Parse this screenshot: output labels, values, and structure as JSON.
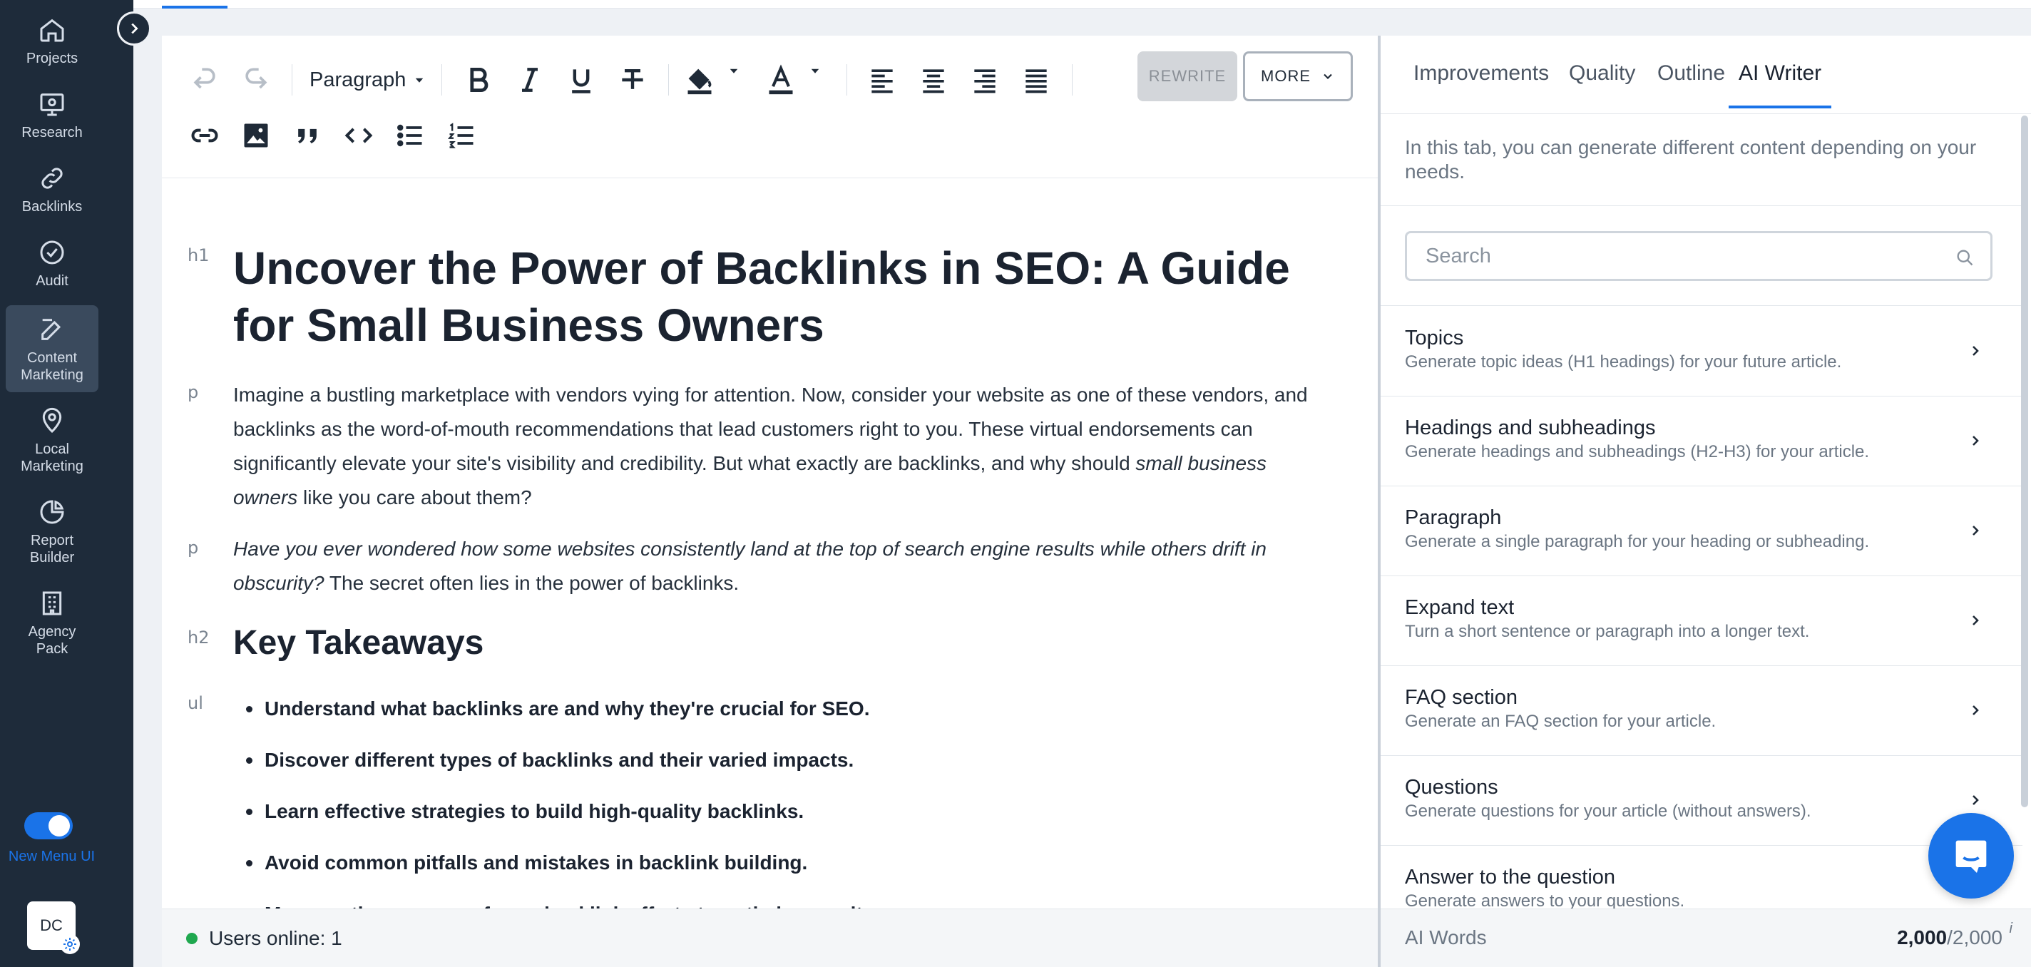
{
  "sidebar": {
    "items": [
      {
        "label": "Projects",
        "icon": "home-icon"
      },
      {
        "label": "Research",
        "icon": "monitor-icon"
      },
      {
        "label": "Backlinks",
        "icon": "link-icon"
      },
      {
        "label": "Audit",
        "icon": "check-circle-icon"
      },
      {
        "label": "Content Marketing",
        "icon": "edit-icon",
        "active": true
      },
      {
        "label": "Local Marketing",
        "icon": "map-pin-icon"
      },
      {
        "label": "Report Builder",
        "icon": "pie-chart-icon"
      },
      {
        "label": "Agency Pack",
        "icon": "building-icon"
      }
    ],
    "toggle_label": "New Menu UI",
    "avatar_initials": "DC"
  },
  "toolbar": {
    "paragraph_select": "Paragraph",
    "rewrite_label": "REWRITE",
    "more_label": "MORE"
  },
  "document": {
    "tags": {
      "h1": "h1",
      "p": "p",
      "h2": "h2",
      "ul": "ul"
    },
    "h1": "Uncover the Power of Backlinks in SEO: A Guide for Small Business Owners",
    "p1_a": "Imagine a bustling marketplace with vendors vying for attention. Now, consider your website as one of these vendors, and backlinks as the word-of-mouth recommendations that lead customers right to you. These virtual endorsements can significantly elevate your site's visibility and credibility. But what exactly are backlinks, and why should ",
    "p1_em": "small business owners",
    "p1_b": " like you care about them?",
    "p2_em": "Have you ever wondered how some websites consistently land at the top of search engine results while others drift in obscurity?",
    "p2_b": " The secret often lies in the power of backlinks.",
    "h2": "Key Takeaways",
    "list": [
      "Understand what backlinks are and why they're crucial for SEO.",
      "Discover different types of backlinks and their varied impacts.",
      "Learn effective strategies to build high-quality backlinks.",
      "Avoid common pitfalls and mistakes in backlink building.",
      "Measure the success of your backlink efforts to optimize results."
    ]
  },
  "status": {
    "users_online": "Users online: 1"
  },
  "right_panel": {
    "tabs": [
      "Improvements",
      "Quality",
      "Outline",
      "AI Writer"
    ],
    "active_tab": "AI Writer",
    "description": "In this tab, you can generate different content depending on your needs.",
    "search_placeholder": "Search",
    "items": [
      {
        "title": "Topics",
        "sub": "Generate topic ideas (H1 headings) for your future article."
      },
      {
        "title": "Headings and subheadings",
        "sub": "Generate headings and subheadings (H2-H3) for your article."
      },
      {
        "title": "Paragraph",
        "sub": "Generate a single paragraph for your heading or subheading."
      },
      {
        "title": "Expand text",
        "sub": "Turn a short sentence or paragraph into a longer text."
      },
      {
        "title": "FAQ section",
        "sub": "Generate an FAQ section for your article."
      },
      {
        "title": "Questions",
        "sub": "Generate questions for your article (without answers)."
      },
      {
        "title": "Answer to the question",
        "sub": "Generate answers to your questions."
      }
    ],
    "footer": {
      "label": "AI Words",
      "used": "2,000",
      "total": "/2,000",
      "info": "i"
    }
  },
  "colors": {
    "accent": "#1a73e8",
    "sidebar_bg": "#1e2b3a",
    "online": "#1fa84f"
  }
}
